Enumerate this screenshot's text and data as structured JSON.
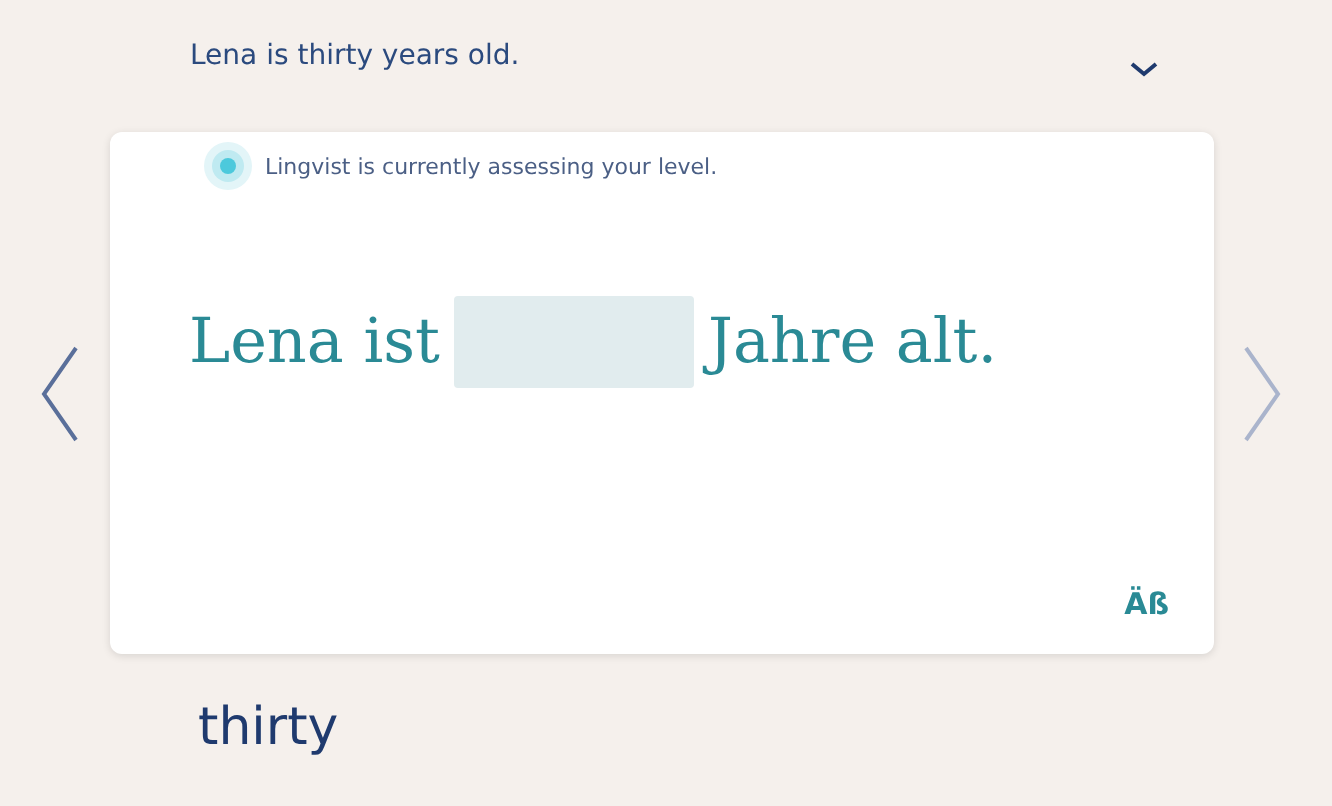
{
  "translation": "Lena is thirty years old.",
  "card": {
    "status": "Lingvist is currently assessing your level.",
    "sentence_before": "Lena ist",
    "sentence_after": "Jahre alt.",
    "special_chars": "Äß"
  },
  "nav": [
    {
      "kind": "prev",
      "disabled": false
    },
    {
      "kind": "next",
      "disabled": true
    }
  ],
  "hint_word": "thirty"
}
